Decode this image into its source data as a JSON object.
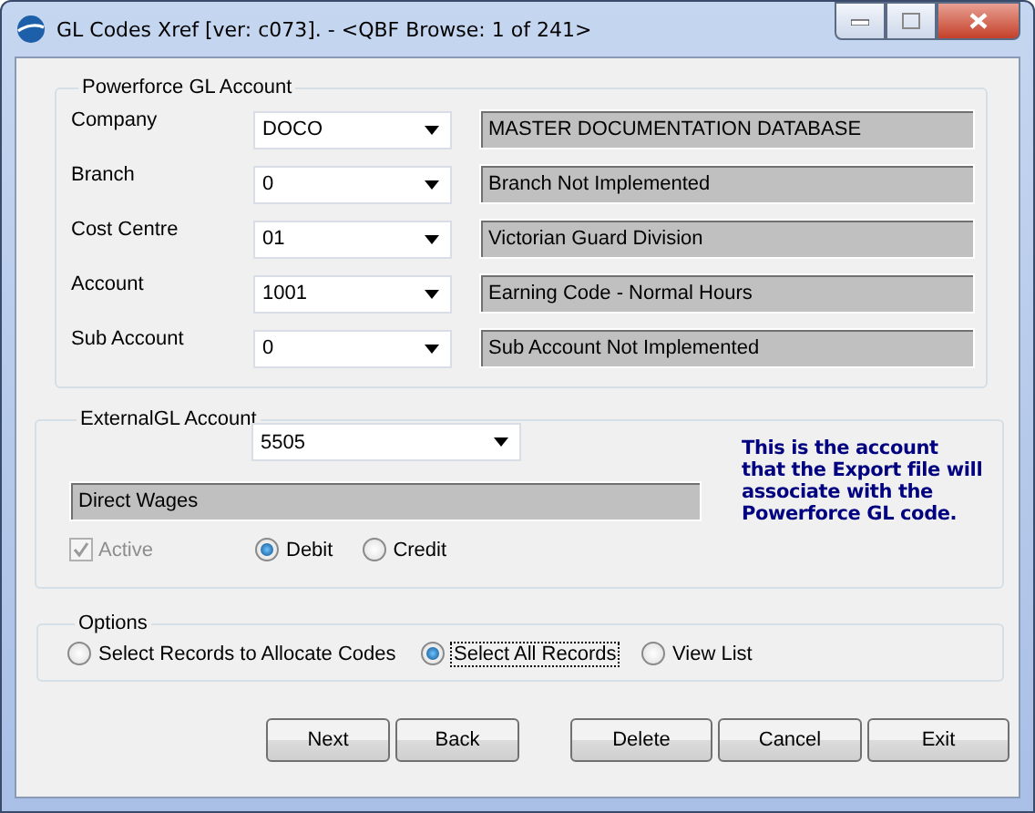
{
  "window": {
    "title": "GL Codes Xref [ver: c073]. - <QBF Browse: 1 of 241>"
  },
  "powerforce_account": {
    "legend": "Powerforce GL Account",
    "rows": [
      {
        "label": "Company",
        "value": "DOCO",
        "description": "MASTER DOCUMENTATION DATABASE"
      },
      {
        "label": "Branch",
        "value": "0",
        "description": "Branch Not Implemented"
      },
      {
        "label": "Cost Centre",
        "value": "01",
        "description": "Victorian Guard Division"
      },
      {
        "label": "Account",
        "value": "1001",
        "description": "Earning Code - Normal Hours"
      },
      {
        "label": "Sub Account",
        "value": "0",
        "description": "Sub Account Not Implemented"
      }
    ]
  },
  "external_account": {
    "legend": "ExternalGL Account",
    "value": "5505",
    "description": "Direct Wages",
    "note": "This is the account that the Export file will associate with the Powerforce GL code.",
    "active": {
      "label": "Active",
      "checked": true,
      "disabled": true
    },
    "types": [
      {
        "label": "Debit",
        "selected": true
      },
      {
        "label": "Credit",
        "selected": false
      }
    ]
  },
  "options": {
    "legend": "Options",
    "items": [
      {
        "label": "Select Records to Allocate Codes",
        "selected": false
      },
      {
        "label": "Select All Records",
        "selected": true
      },
      {
        "label": "View List",
        "selected": false
      }
    ]
  },
  "buttons": [
    {
      "label": "Next"
    },
    {
      "label": "Back"
    },
    {
      "label": "Delete"
    },
    {
      "label": "Cancel"
    },
    {
      "label": "Exit"
    }
  ]
}
